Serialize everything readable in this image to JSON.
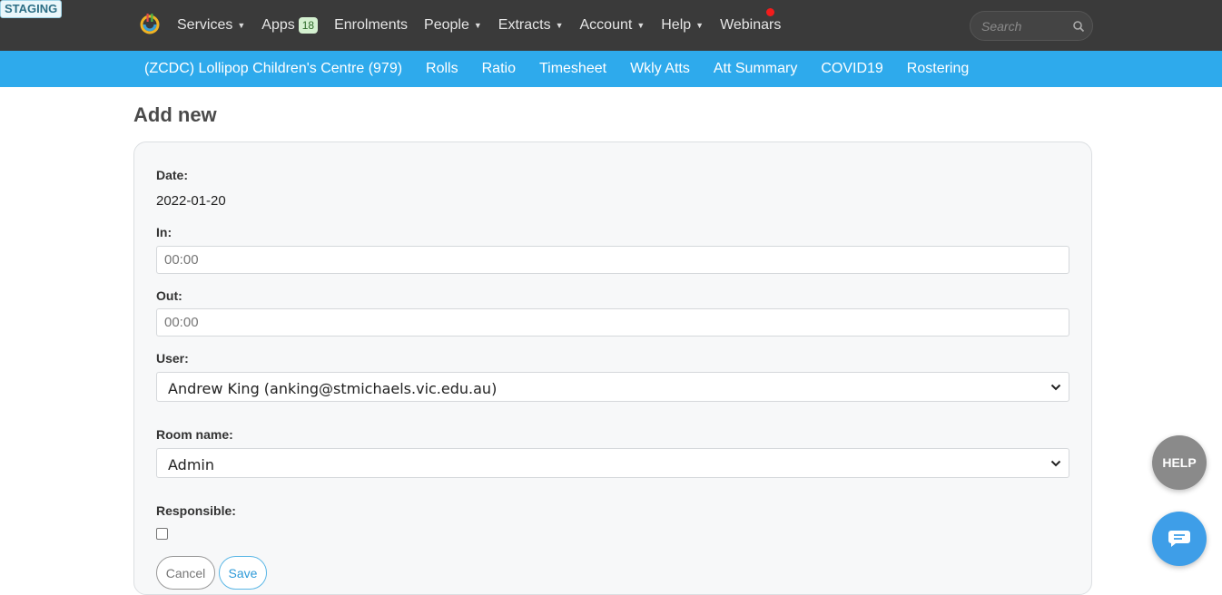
{
  "env_badge": "STAGING",
  "topnav": {
    "items": [
      {
        "label": "Services",
        "caret": true
      },
      {
        "label": "Apps",
        "badge": "18"
      },
      {
        "label": "Enrolments"
      },
      {
        "label": "People",
        "caret": true
      },
      {
        "label": "Extracts",
        "caret": true
      },
      {
        "label": "Account",
        "caret": true
      },
      {
        "label": "Help",
        "caret": true
      },
      {
        "label": "Webinars"
      }
    ],
    "search_placeholder": "Search"
  },
  "subnav": {
    "items": [
      "(ZCDC) Lollipop Children's Centre (979)",
      "Rolls",
      "Ratio",
      "Timesheet",
      "Wkly Atts",
      "Att Summary",
      "COVID19",
      "Rostering"
    ]
  },
  "page": {
    "title": "Add new"
  },
  "form": {
    "date_label": "Date:",
    "date_value": "2022-01-20",
    "in_label": "In:",
    "in_placeholder": "00:00",
    "out_label": "Out:",
    "out_placeholder": "00:00",
    "user_label": "User:",
    "user_value": "Andrew King (anking@stmichaels.vic.edu.au)",
    "room_label": "Room name:",
    "room_value": "Admin",
    "responsible_label": "Responsible:",
    "responsible_checked": false,
    "cancel_label": "Cancel",
    "save_label": "Save"
  },
  "floating": {
    "help_label": "HELP"
  },
  "colors": {
    "topbar": "#3a3a3a",
    "subbar": "#2eaaec",
    "accent": "#2e9ad8",
    "notification": "#f21c1c"
  }
}
